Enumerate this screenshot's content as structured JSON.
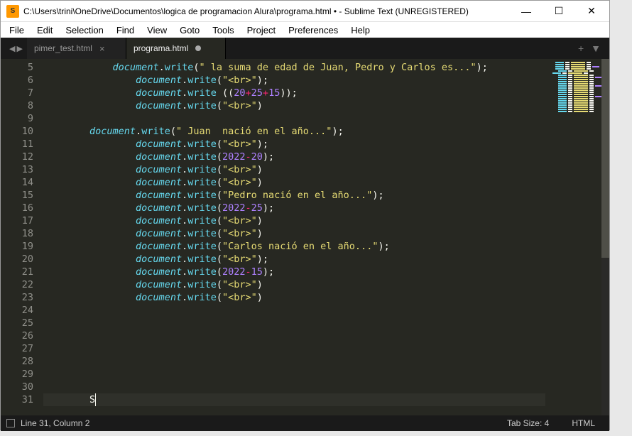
{
  "window": {
    "title": "C:\\Users\\trini\\OneDrive\\Documentos\\logica de programacion Alura\\programa.html • - Sublime Text (UNREGISTERED)"
  },
  "menu": {
    "items": [
      "File",
      "Edit",
      "Selection",
      "Find",
      "View",
      "Goto",
      "Tools",
      "Project",
      "Preferences",
      "Help"
    ]
  },
  "tabs": {
    "nav_left": "◀",
    "nav_right": "▶",
    "list": [
      {
        "label": "pimer_test.html",
        "active": false,
        "dirty": false
      },
      {
        "label": "programa.html",
        "active": true,
        "dirty": true
      }
    ],
    "add": "+",
    "dropdown": "▼"
  },
  "gutter": {
    "start": 5,
    "end": 31
  },
  "code": {
    "l5": {
      "indent": "            ",
      "obj": "document",
      "method": "write",
      "args_open": "(",
      "str": "\" la suma de edad de Juan, Pedro y Carlos es...\"",
      "args_close": ");"
    },
    "l6": {
      "indent": "                ",
      "obj": "document",
      "method": "write",
      "args_open": "(",
      "str": "\"<br>\"",
      "args_close": ");"
    },
    "l7": {
      "indent": "                ",
      "obj": "document",
      "method": "write",
      "args_open": " ((",
      "n1": "20",
      "op1": "+",
      "n2": "25",
      "op2": "+",
      "n3": "15",
      "args_close": "));"
    },
    "l8": {
      "indent": "                ",
      "obj": "document",
      "method": "write",
      "args_open": "(",
      "str": "\"<br>\"",
      "args_close": ")"
    },
    "l10": {
      "indent": "        ",
      "obj": "document",
      "method": "write",
      "args_open": "(",
      "str": "\" Juan  nació en el año...\"",
      "args_close": ");"
    },
    "l11": {
      "indent": "                ",
      "obj": "document",
      "method": "write",
      "args_open": "(",
      "str": "\"<br>\"",
      "args_close": ");"
    },
    "l12": {
      "indent": "                ",
      "obj": "document",
      "method": "write",
      "args_open": "(",
      "n1": "2022",
      "op1": "-",
      "n2": "20",
      "args_close": ");"
    },
    "l13": {
      "indent": "                ",
      "obj": "document",
      "method": "write",
      "args_open": "(",
      "str": "\"<br>\"",
      "args_close": ")"
    },
    "l14": {
      "indent": "                ",
      "obj": "document",
      "method": "write",
      "args_open": "(",
      "str": "\"<br>\"",
      "args_close": ")"
    },
    "l15": {
      "indent": "                ",
      "obj": "document",
      "method": "write",
      "args_open": "(",
      "str": "\"Pedro nació en el año...\"",
      "args_close": ");"
    },
    "l16": {
      "indent": "                ",
      "obj": "document",
      "method": "write",
      "args_open": "(",
      "n1": "2022",
      "op1": "-",
      "n2": "25",
      "args_close": ");"
    },
    "l17": {
      "indent": "                ",
      "obj": "document",
      "method": "write",
      "args_open": "(",
      "str": "\"<br>\"",
      "args_close": ")"
    },
    "l18": {
      "indent": "                ",
      "obj": "document",
      "method": "write",
      "args_open": "(",
      "str": "\"<br>\"",
      "args_close": ")"
    },
    "l19": {
      "indent": "                ",
      "obj": "document",
      "method": "write",
      "args_open": "(",
      "str": "\"Carlos nació en el año...\"",
      "args_close": ");"
    },
    "l20": {
      "indent": "                ",
      "obj": "document",
      "method": "write",
      "args_open": "(",
      "str": "\"<br>\"",
      "args_close": ");"
    },
    "l21": {
      "indent": "                ",
      "obj": "document",
      "method": "write",
      "args_open": "(",
      "n1": "2022",
      "op1": "-",
      "n2": "15",
      "args_close": ");"
    },
    "l22": {
      "indent": "                ",
      "obj": "document",
      "method": "write",
      "args_open": "(",
      "str": "\"<br>\"",
      "args_close": ")"
    },
    "l23": {
      "indent": "                ",
      "obj": "document",
      "method": "write",
      "args_open": "(",
      "str": "\"<br>\"",
      "args_close": ")"
    },
    "l31": {
      "indent": "        ",
      "char": "S"
    }
  },
  "status": {
    "position": "Line 31, Column 2",
    "tabsize": "Tab Size: 4",
    "syntax": "HTML"
  }
}
